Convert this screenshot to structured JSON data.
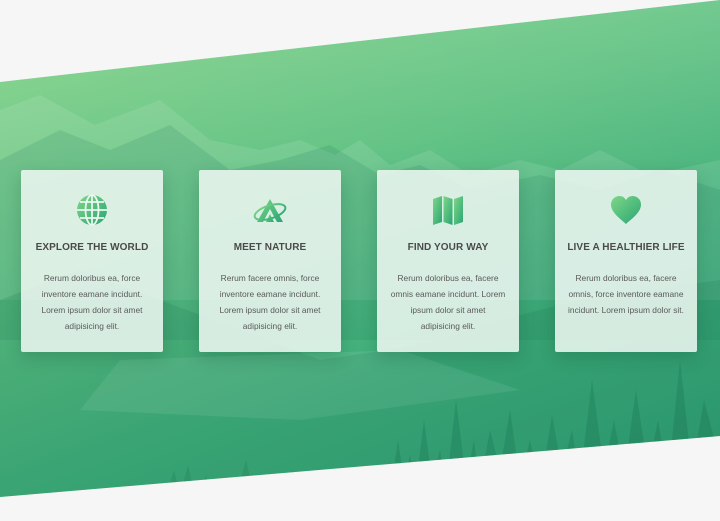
{
  "theme": {
    "accent_light": "#86d38a",
    "accent_dark": "#2a9a72",
    "card_bg": "#ecf6f0",
    "page_bg": "#f6f6f6"
  },
  "cards": [
    {
      "icon": "globe-icon",
      "title": "EXPLORE THE WORLD",
      "text": "Rerum doloribus ea, force inventore eamane incidunt. Lorem ipsum dolor sit amet adipisicing elit."
    },
    {
      "icon": "mountain-logo-icon",
      "title": "MEET NATURE",
      "text": "Rerum facere omnis, force inventore eamane incidunt. Lorem ipsum dolor sit amet adipisicing elit."
    },
    {
      "icon": "map-icon",
      "title": "FIND YOUR WAY",
      "text": "Rerum doloribus ea, facere omnis eamane incidunt. Lorem ipsum dolor sit amet adipisicing elit."
    },
    {
      "icon": "heart-icon",
      "title": "LIVE A HEALTHIER LIFE",
      "text": "Rerum doloribus ea, facere omnis, force inventore eamane incidunt. Lorem ipsum dolor sit."
    }
  ]
}
